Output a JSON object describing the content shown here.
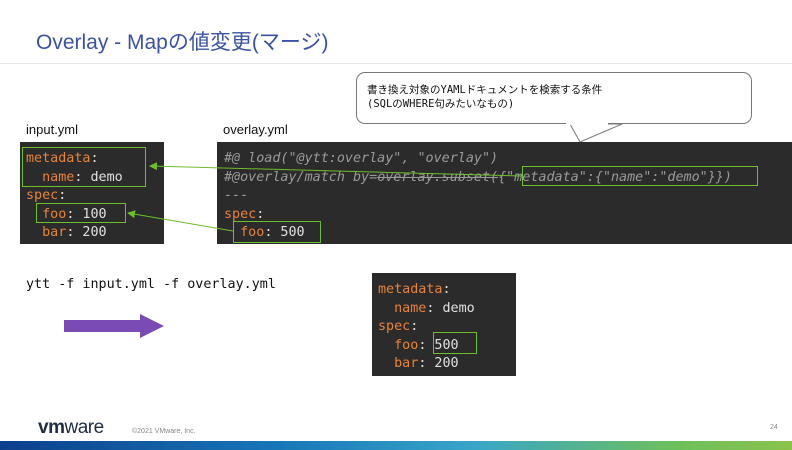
{
  "slide": {
    "title": "Overlay - Mapの値変更(マージ)",
    "page_number": "24",
    "copyright": "©2021 VMware, Inc.",
    "logo_vm": "vm",
    "logo_ware": "ware"
  },
  "input": {
    "label": "input.yml",
    "k_metadata": "metadata",
    "k_name": "name",
    "v_name": " demo",
    "k_spec": "spec",
    "k_foo": "foo",
    "v_foo": " 100",
    "k_bar": "bar",
    "v_bar": " 200"
  },
  "overlay": {
    "label": "overlay.yml",
    "line1": "#@ load(\"@ytt:overlay\", \"overlay\")",
    "line2_pre": "#@overlay/match by=",
    "line2_mid": "overlay.subset(",
    "line2_map": "{\"metadata\":{\"name\":\"demo\"}",
    "line2_post": "})",
    "line3": "---",
    "k_spec": "spec",
    "k_foo": "foo",
    "v_foo": " 500"
  },
  "callout": {
    "line1": "書き換え対象のYAMLドキュメントを検索する条件",
    "line2": "(SQLのWHERE句みたいなもの)"
  },
  "command": {
    "text": "ytt -f input.yml -f overlay.yml"
  },
  "result": {
    "k_metadata": "metadata",
    "k_name": "name",
    "v_name": " demo",
    "k_spec": "spec",
    "k_foo": "foo",
    "v_foo": " 500",
    "k_bar": "bar",
    "v_bar": " 200"
  },
  "colors": {
    "title": "#3a53a3",
    "key": "#e8833a",
    "highlight_box": "#6cbf2d",
    "arrow": "#7b4bb5",
    "code_bg": "#2b2b2b"
  }
}
